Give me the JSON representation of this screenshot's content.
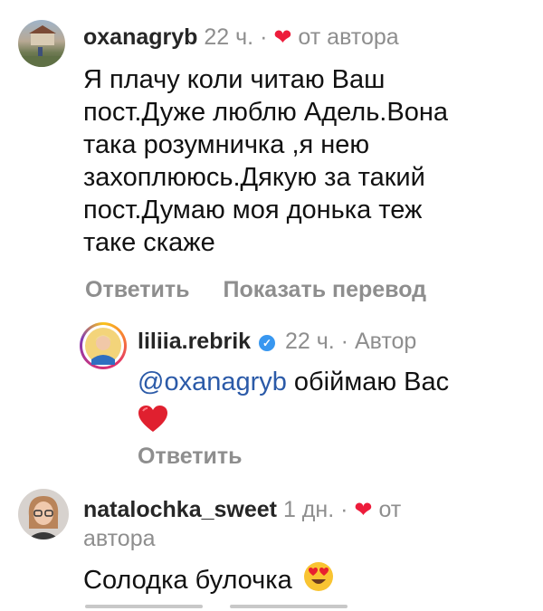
{
  "comments": [
    {
      "username": "oxanagryb",
      "time": "22 ч.",
      "dot": "·",
      "liked_by_author_label": "от автора",
      "text_lines": [
        "Я плачу коли читаю Ваш",
        "пост.Дуже люблю Адель.Вона",
        "така розумничка ,я нею",
        "захоплююсь.Дякую за такий",
        "пост.Думаю моя донька теж",
        "таке скаже"
      ],
      "reply_label": "Ответить",
      "translate_label": "Показать перевод"
    },
    {
      "username": "liliia.rebrik",
      "time": "22 ч.",
      "dot": "·",
      "author_label": "Автор",
      "mention": "@oxanagryb",
      "text": " обіймаю Вас",
      "emoji": "red-heart",
      "reply_label": "Ответить"
    },
    {
      "username": "natalochka_sweet",
      "time": "1 дн.",
      "dot": "·",
      "liked_by_author_label_1": "от",
      "liked_by_author_label_2": "автора",
      "text": "Солодка булочка",
      "emoji": "heart-eyes"
    }
  ],
  "colors": {
    "heart": "#ed1c3b",
    "mention": "#2b5aa8",
    "muted": "#8e8e8e",
    "verified": "#3897f0"
  }
}
